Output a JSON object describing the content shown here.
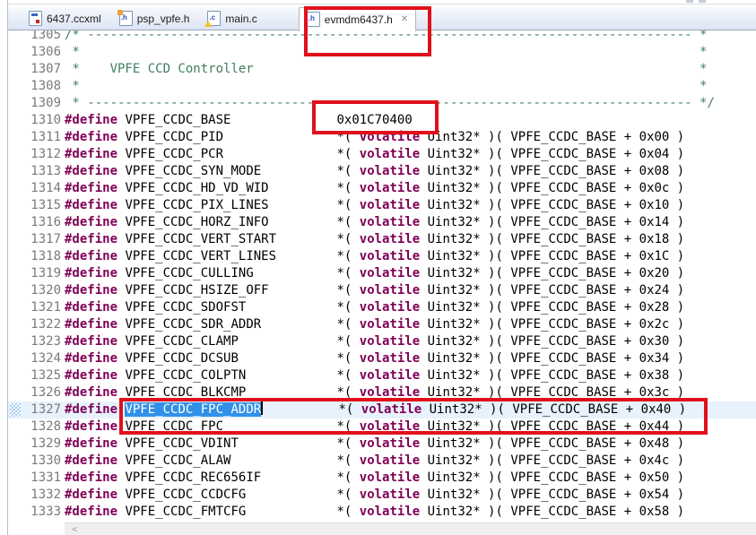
{
  "colors": {
    "annotation_red": "#e0101b",
    "selection_blue": "#3191e8",
    "current_line": "#e8f2fd",
    "keyword_purple": "#7f0055",
    "comment_green": "#3f7f5f",
    "line_number_gray": "#7a7a7a",
    "tab_bar_gradient_top": "#f7f9fd",
    "tab_bar_gradient_bottom": "#dce4f4"
  },
  "tab_bar": {
    "tabs": [
      {
        "label": "6437.ccxml",
        "icon": "target-config-icon",
        "active": false
      },
      {
        "label": "psp_vpfe.h",
        "icon": "header-file-icon",
        "active": false,
        "fold": true
      },
      {
        "label": "main.c",
        "icon": "c-file-warning-icon",
        "active": false
      },
      {
        "label": "evmdm6437.h",
        "icon": "header-file-icon",
        "active": true,
        "close_glyph": "✕"
      }
    ]
  },
  "editor": {
    "body_template": {
      "pre": "*( ",
      "keyword": "volatile",
      "mid": " Uint32* )( VPFE_CCDC_BASE + ",
      "post": " )"
    },
    "define_keyword": "#define",
    "name_col_width": 28,
    "lines": [
      {
        "num": 1305,
        "kind": "comment",
        "prefix": "/* ",
        "fill": "-",
        "fill_to": 83,
        "suffix": " *"
      },
      {
        "num": 1306,
        "kind": "comment",
        "prefix": " *",
        "fill": " ",
        "fill_to": 84,
        "suffix": "*"
      },
      {
        "num": 1307,
        "kind": "comment",
        "prefix": " *    VPFE CCD Controller",
        "fill": " ",
        "fill_to": 84,
        "suffix": "*"
      },
      {
        "num": 1308,
        "kind": "comment",
        "prefix": " *",
        "fill": " ",
        "fill_to": 84,
        "suffix": "*"
      },
      {
        "num": 1309,
        "kind": "comment",
        "prefix": " * ",
        "fill": "-",
        "fill_to": 83,
        "suffix": " */"
      },
      {
        "num": 1310,
        "kind": "define",
        "name": "VPFE_CCDC_BASE",
        "value": "0x01C70400"
      },
      {
        "num": 1311,
        "kind": "define",
        "name": "VPFE_CCDC_PID",
        "offset": "0x00"
      },
      {
        "num": 1312,
        "kind": "define",
        "name": "VPFE_CCDC_PCR",
        "offset": "0x04"
      },
      {
        "num": 1313,
        "kind": "define",
        "name": "VPFE_CCDC_SYN_MODE",
        "offset": "0x08"
      },
      {
        "num": 1314,
        "kind": "define",
        "name": "VPFE_CCDC_HD_VD_WID",
        "offset": "0x0c"
      },
      {
        "num": 1315,
        "kind": "define",
        "name": "VPFE_CCDC_PIX_LINES",
        "offset": "0x10"
      },
      {
        "num": 1316,
        "kind": "define",
        "name": "VPFE_CCDC_HORZ_INFO",
        "offset": "0x14"
      },
      {
        "num": 1317,
        "kind": "define",
        "name": "VPFE_CCDC_VERT_START",
        "offset": "0x18"
      },
      {
        "num": 1318,
        "kind": "define",
        "name": "VPFE_CCDC_VERT_LINES",
        "offset": "0x1C"
      },
      {
        "num": 1319,
        "kind": "define",
        "name": "VPFE_CCDC_CULLING",
        "offset": "0x20"
      },
      {
        "num": 1320,
        "kind": "define",
        "name": "VPFE_CCDC_HSIZE_OFF",
        "offset": "0x24"
      },
      {
        "num": 1321,
        "kind": "define",
        "name": "VPFE_CCDC_SDOFST",
        "offset": "0x28"
      },
      {
        "num": 1322,
        "kind": "define",
        "name": "VPFE_CCDC_SDR_ADDR",
        "offset": "0x2c"
      },
      {
        "num": 1323,
        "kind": "define",
        "name": "VPFE_CCDC_CLAMP",
        "offset": "0x30"
      },
      {
        "num": 1324,
        "kind": "define",
        "name": "VPFE_CCDC_DCSUB",
        "offset": "0x34"
      },
      {
        "num": 1325,
        "kind": "define",
        "name": "VPFE_CCDC_COLPTN",
        "offset": "0x38"
      },
      {
        "num": 1326,
        "kind": "define",
        "name": "VPFE_CCDC_BLKCMP",
        "offset": "0x3c"
      },
      {
        "num": 1327,
        "kind": "define",
        "name": "VPFE_CCDC_FPC_ADDR",
        "offset": "0x40",
        "selected": true,
        "current_line": true
      },
      {
        "num": 1328,
        "kind": "define",
        "name": "VPFE_CCDC_FPC",
        "offset": "0x44"
      },
      {
        "num": 1329,
        "kind": "define",
        "name": "VPFE_CCDC_VDINT",
        "offset": "0x48"
      },
      {
        "num": 1330,
        "kind": "define",
        "name": "VPFE_CCDC_ALAW",
        "offset": "0x4c"
      },
      {
        "num": 1331,
        "kind": "define",
        "name": "VPFE_CCDC_REC656IF",
        "offset": "0x50"
      },
      {
        "num": 1332,
        "kind": "define",
        "name": "VPFE_CCDC_CCDCFG",
        "offset": "0x54"
      },
      {
        "num": 1333,
        "kind": "define",
        "name": "VPFE_CCDC_FMTCFG",
        "offset": "0x58"
      }
    ]
  },
  "scrollbar": {
    "left_arrow": "<"
  }
}
